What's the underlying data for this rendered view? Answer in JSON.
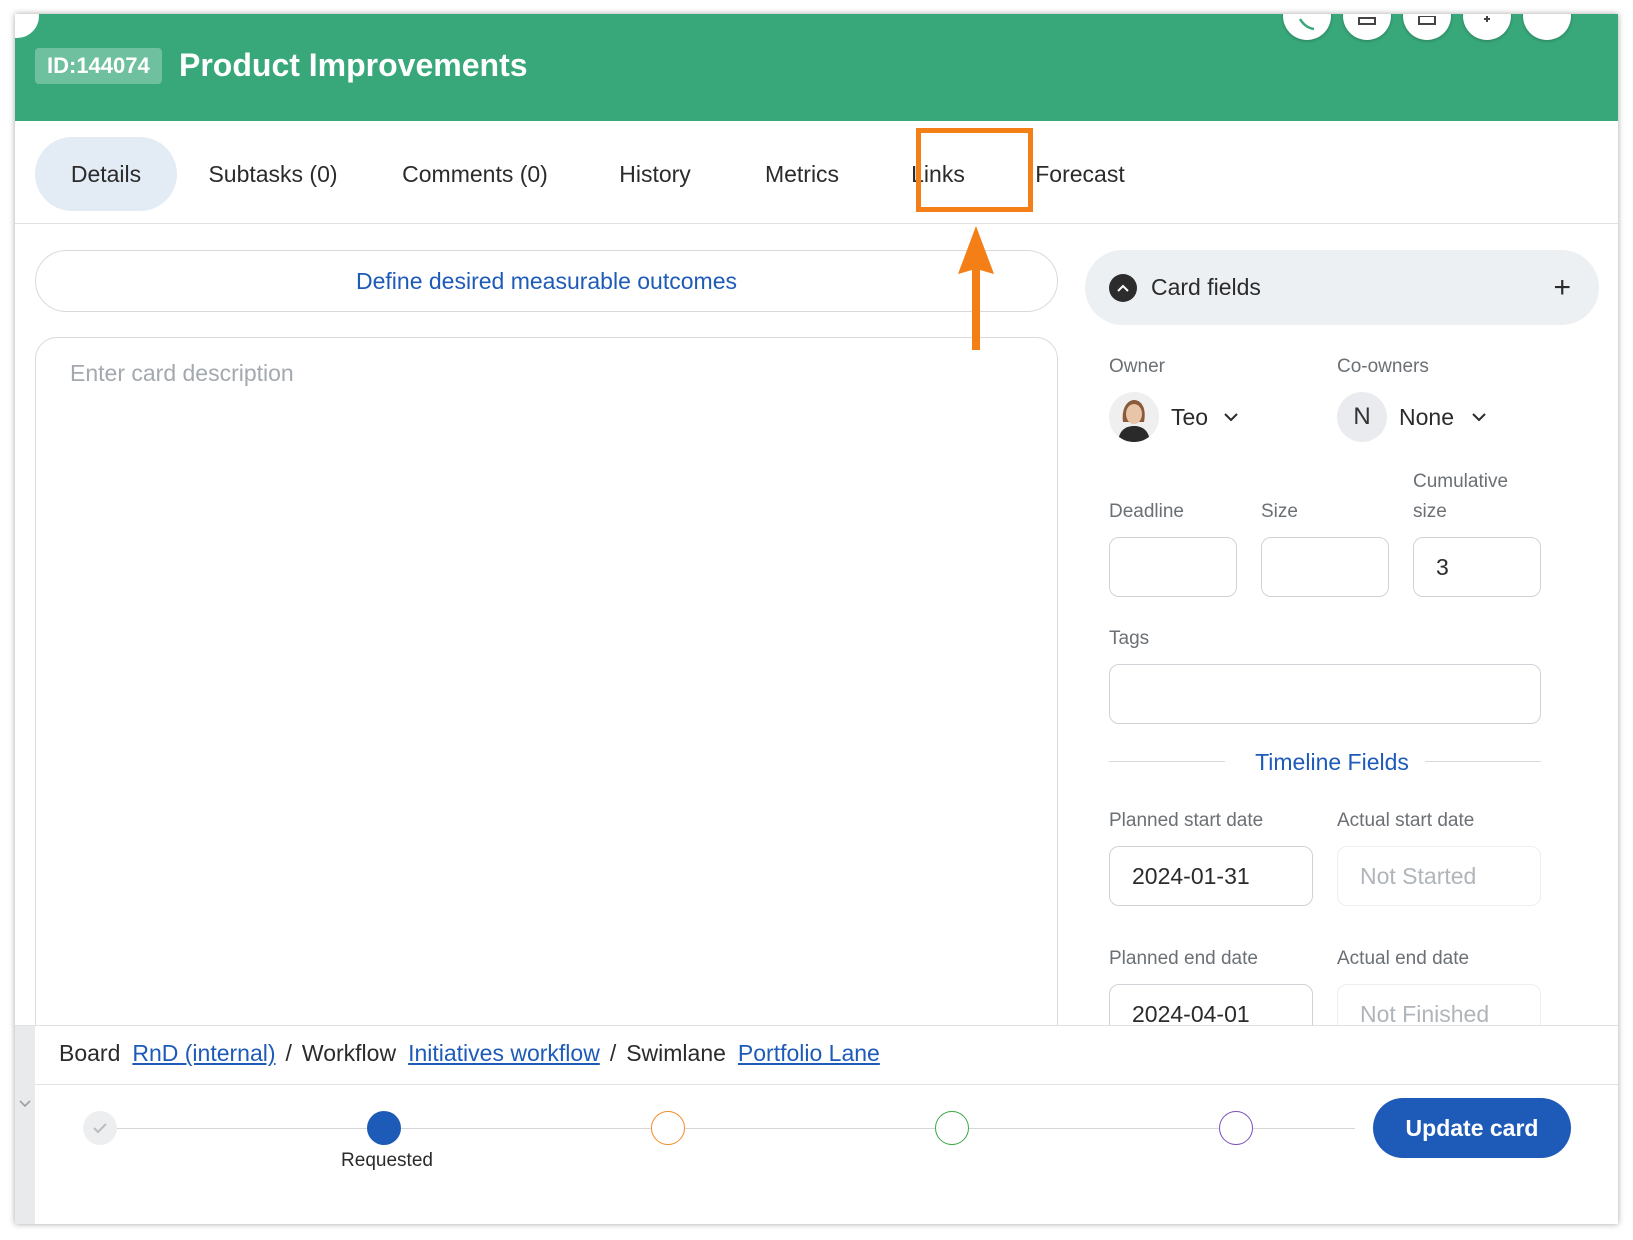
{
  "header": {
    "card_id": "ID:144074",
    "title": "Product Improvements",
    "accent_color": "#38a87a"
  },
  "tabs": [
    {
      "label": "Details",
      "active": true
    },
    {
      "label": "Subtasks (0)"
    },
    {
      "label": "Comments (0)"
    },
    {
      "label": "History"
    },
    {
      "label": "Metrics"
    },
    {
      "label": "Links",
      "highlighted": true
    },
    {
      "label": "Forecast"
    }
  ],
  "highlight_color": "#f57f17",
  "main": {
    "outcomes_button": "Define desired measurable outcomes",
    "description_placeholder": "Enter card description"
  },
  "card_fields": {
    "title": "Card fields",
    "add_icon": "plus-icon",
    "owner_label": "Owner",
    "owner_name": "Teo",
    "coowners_label": "Co-owners",
    "coowners_initial": "N",
    "coowners_value": "None",
    "deadline_label": "Deadline",
    "deadline_value": "",
    "size_label": "Size",
    "size_value": "",
    "cumulative_label_line1": "Cumulative",
    "cumulative_label_line2": "size",
    "cumulative_value": "3",
    "tags_label": "Tags",
    "tags_value": "",
    "timeline_title": "Timeline Fields",
    "planned_start_label": "Planned start date",
    "planned_start_value": "2024-01-31",
    "actual_start_label": "Actual start date",
    "actual_start_value": "Not Started",
    "planned_end_label": "Planned end date",
    "planned_end_value": "2024-04-01",
    "actual_end_label": "Actual end date",
    "actual_end_value": "Not Finished"
  },
  "footer": {
    "board_label": "Board",
    "board_link": "RnD (internal)",
    "workflow_label": "Workflow",
    "workflow_link": "Initiatives workflow",
    "swimlane_label": "Swimlane",
    "swimlane_link": "Portfolio Lane",
    "separator": "/",
    "current_stage": "Requested",
    "update_button": "Update card",
    "stage_colors": [
      "#cccccc",
      "#1e5bb8",
      "#f28c28",
      "#3aa845",
      "#7b4fb8"
    ]
  }
}
